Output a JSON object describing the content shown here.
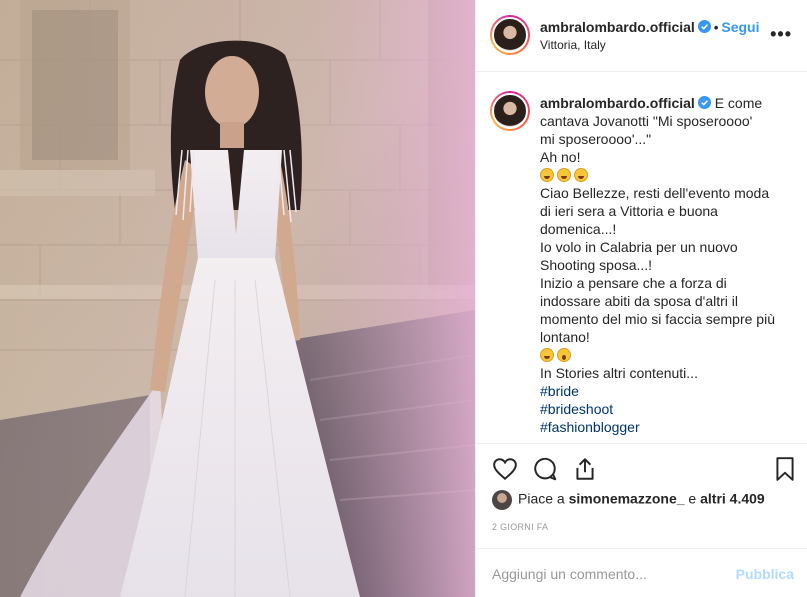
{
  "post": {
    "author": {
      "username": "ambralombardo.official",
      "verified": true,
      "location": "Vittoria, Italy",
      "avatar_icon": "profile-photo"
    },
    "header": {
      "follow_separator": "•",
      "follow_label": "Segui",
      "more_label": "•••"
    },
    "caption": {
      "username": "ambralombardo.official",
      "lines": [
        "E come cantava Jovanotti \"Mi sposeroooo'",
        "mi sposeroooo'...\"",
        "Ah no!",
        "",
        "Ciao Bellezze, resti dell'evento moda di ieri sera a Vittoria e buona domenica...!",
        "Io volo in Calabria per un nuovo Shooting sposa...!",
        "Inizio a pensare che a forza di indossare abiti da sposa d'altri il momento del mio si faccia sempre più lontano!",
        "",
        "In Stories altri contenuti..."
      ],
      "emoji_rows": [
        [
          "grinning-squint-face",
          "grinning-squint-face",
          "grinning-squint-face"
        ],
        [
          "grinning-squint-face",
          "astonished-face"
        ]
      ],
      "hashtags": [
        "#bride",
        "#brideshoot",
        "#fashionblogger"
      ]
    },
    "actions": {
      "icons": [
        "heart-icon",
        "comment-icon",
        "share-icon",
        "bookmark-icon"
      ]
    },
    "likes": {
      "prefix": "Piace a",
      "user": "simonemazzone_",
      "middle": "e",
      "others": "altri 4.409"
    },
    "timestamp": "2 giorni fa",
    "comment": {
      "placeholder": "Aggiungi un commento...",
      "publish_label": "Pubblica"
    },
    "colors": {
      "link": "#3897f0",
      "hashtag": "#003569",
      "publish_disabled": "#b3dbff",
      "border": "#efefef"
    }
  }
}
